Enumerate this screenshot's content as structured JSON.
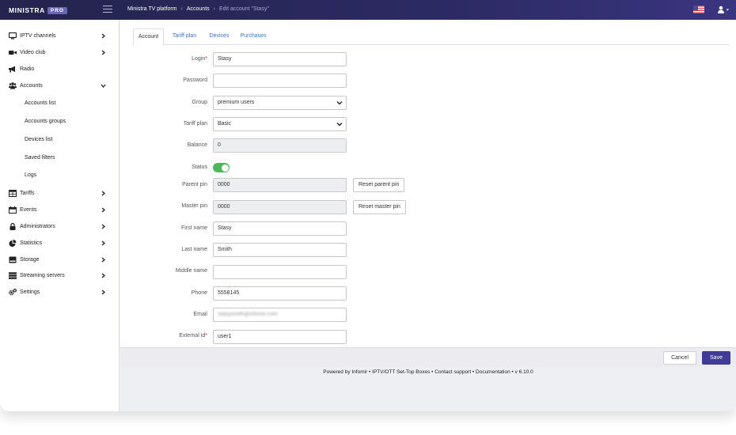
{
  "header": {
    "logo_text": "MINISTRA",
    "logo_badge": "PRO",
    "breadcrumbs": [
      "Ministra TV platform",
      "Accounts",
      "Edit account \"Stasy\""
    ],
    "breadcrumb_sep": "›",
    "language_flag_icon": "us-flag-icon",
    "user_menu_icon": "user-icon"
  },
  "sidebar": {
    "items": [
      {
        "label": "IPTV channels",
        "icon": "tv-icon",
        "chevron": "chevron-right-icon"
      },
      {
        "label": "Video club",
        "icon": "video-camera-icon",
        "chevron": "chevron-right-icon"
      },
      {
        "label": "Radio",
        "icon": "megaphone-icon"
      },
      {
        "label": "Accounts",
        "icon": "users-icon",
        "chevron": "chevron-down-icon"
      },
      {
        "label": "Accounts list"
      },
      {
        "label": "Accounts groups"
      },
      {
        "label": "Devices list"
      },
      {
        "label": "Saved filters"
      },
      {
        "label": "Logs"
      },
      {
        "label": "Tariffs",
        "icon": "table-icon",
        "chevron": "chevron-right-icon"
      },
      {
        "label": "Events",
        "icon": "calendar-icon",
        "chevron": "chevron-right-icon"
      },
      {
        "label": "Administrators",
        "icon": "lock-icon",
        "chevron": "chevron-right-icon"
      },
      {
        "label": "Statistics",
        "icon": "pie-chart-icon",
        "chevron": "chevron-right-icon"
      },
      {
        "label": "Storage",
        "icon": "hdd-icon",
        "chevron": "chevron-right-icon"
      },
      {
        "label": "Streaming servers",
        "icon": "server-icon",
        "chevron": "chevron-right-icon"
      },
      {
        "label": "Settings",
        "icon": "cogs-icon",
        "chevron": "chevron-right-icon"
      }
    ]
  },
  "tabs": [
    "Account",
    "Tariff plan",
    "Devices",
    "Purchases"
  ],
  "form": {
    "login": {
      "label": "Login",
      "required_mark": "*",
      "value": "Stasy"
    },
    "password": {
      "label": "Password",
      "value": ""
    },
    "group": {
      "label": "Group",
      "value": "premium users"
    },
    "tariff_plan": {
      "label": "Tariff plan",
      "value": "Basic"
    },
    "balance": {
      "label": "Balance",
      "value": "0"
    },
    "status": {
      "label": "Status",
      "on": true
    },
    "parent_pin": {
      "label": "Parent pin",
      "value": "0000",
      "button": "Reset parent pin"
    },
    "master_pin": {
      "label": "Master pin",
      "value": "0000",
      "button": "Reset master pin"
    },
    "first_name": {
      "label": "First name",
      "value": "Stasy"
    },
    "last_name": {
      "label": "Last name",
      "value": "Smith"
    },
    "middle_name": {
      "label": "Middle name",
      "value": ""
    },
    "phone": {
      "label": "Phone",
      "value": "5558145"
    },
    "email": {
      "label": "Email",
      "value": "stasysmith@infomir.com"
    },
    "external_id": {
      "label": "External id",
      "required_mark": "*",
      "value": "user1"
    }
  },
  "actions": {
    "cancel": "Cancel",
    "save": "Save"
  },
  "footer": {
    "text": "Powered by Infomir • IPTV/OTT Set-Top Boxes • Contact support • Documentation • v 6.10.0"
  },
  "colors": {
    "header_bg": "#2c2a63",
    "accent": "#3f3b97",
    "link": "#3a73c4",
    "toggle_on": "#4cb85a"
  }
}
